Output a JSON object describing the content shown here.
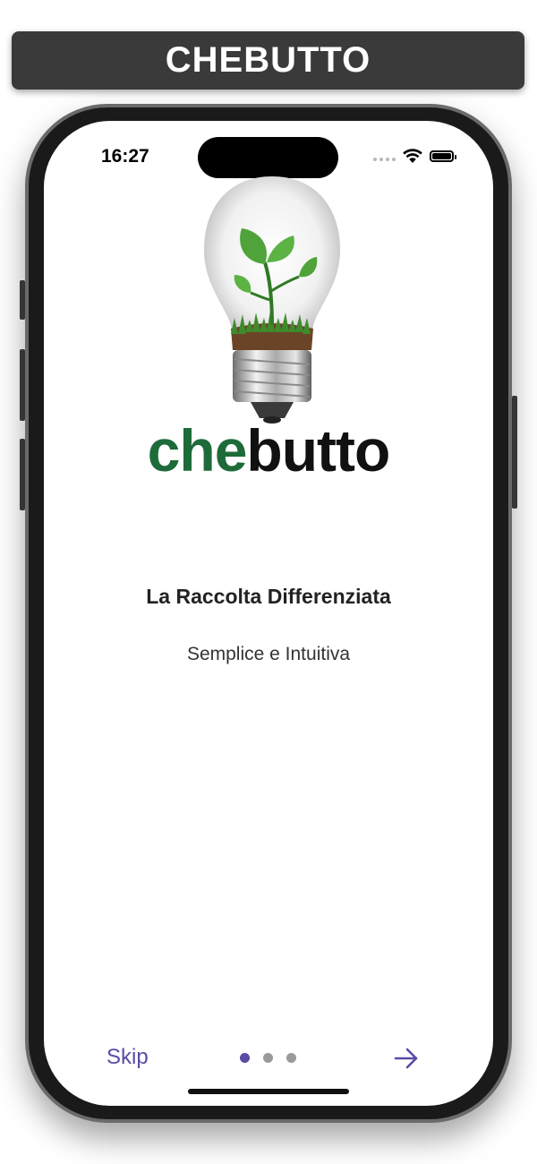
{
  "banner": {
    "title": "CHEBUTTO"
  },
  "status_bar": {
    "time": "16:27",
    "icons": [
      "signal-icon",
      "wifi-icon",
      "battery-icon"
    ]
  },
  "logo": {
    "part1": "che",
    "part2": "butto",
    "colors": {
      "part1": "#1e6b3a",
      "part2": "#111111"
    },
    "image": "lightbulb-with-plant-icon"
  },
  "slide": {
    "title": "La Raccolta Differenziata",
    "subtitle": "Semplice e Intuitiva"
  },
  "navigation": {
    "skip_label": "Skip",
    "page_count": 3,
    "current_page": 1,
    "next_icon": "arrow-right-icon",
    "accent_color": "#5b4aa6"
  }
}
